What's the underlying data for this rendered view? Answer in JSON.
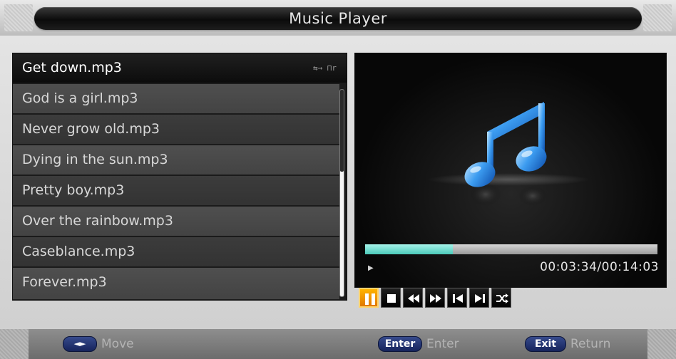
{
  "window": {
    "title": "Music Player"
  },
  "playlist": {
    "files": [
      {
        "name": "Get down.mp3",
        "selected": true,
        "badge": "⇆→ ⊓r"
      },
      {
        "name": "God is a girl.mp3",
        "selected": false
      },
      {
        "name": "Never grow old.mp3",
        "selected": false
      },
      {
        "name": "Dying in the sun.mp3",
        "selected": false
      },
      {
        "name": "Pretty boy.mp3",
        "selected": false
      },
      {
        "name": "Over the rainbow.mp3",
        "selected": false
      },
      {
        "name": "Caseblance.mp3",
        "selected": false
      },
      {
        "name": "Forever.mp3",
        "selected": false
      }
    ]
  },
  "player": {
    "progress_fraction": 0.3,
    "time_display": "00:03:34/00:14:03",
    "play_state_icon": "play-triangle-icon",
    "controls": [
      {
        "icon": "pause-icon",
        "active": true
      },
      {
        "icon": "stop-icon",
        "active": false
      },
      {
        "icon": "rewind-icon",
        "active": false
      },
      {
        "icon": "fast-forward-icon",
        "active": false
      },
      {
        "icon": "previous-track-icon",
        "active": false
      },
      {
        "icon": "next-track-icon",
        "active": false
      },
      {
        "icon": "shuffle-icon",
        "active": false
      }
    ],
    "artwork_icon": "music-note-icon"
  },
  "help_bar": {
    "move": {
      "key": "◄►",
      "label": "Move"
    },
    "enter": {
      "key": "Enter",
      "label": "Enter"
    },
    "exit": {
      "key": "Exit",
      "label": "Return"
    }
  },
  "colors": {
    "accent_active": "#f39a00",
    "progress_fill": "#6fded0",
    "key_pill": "#1f2f6e",
    "note_blue": "#2f8ee8"
  }
}
